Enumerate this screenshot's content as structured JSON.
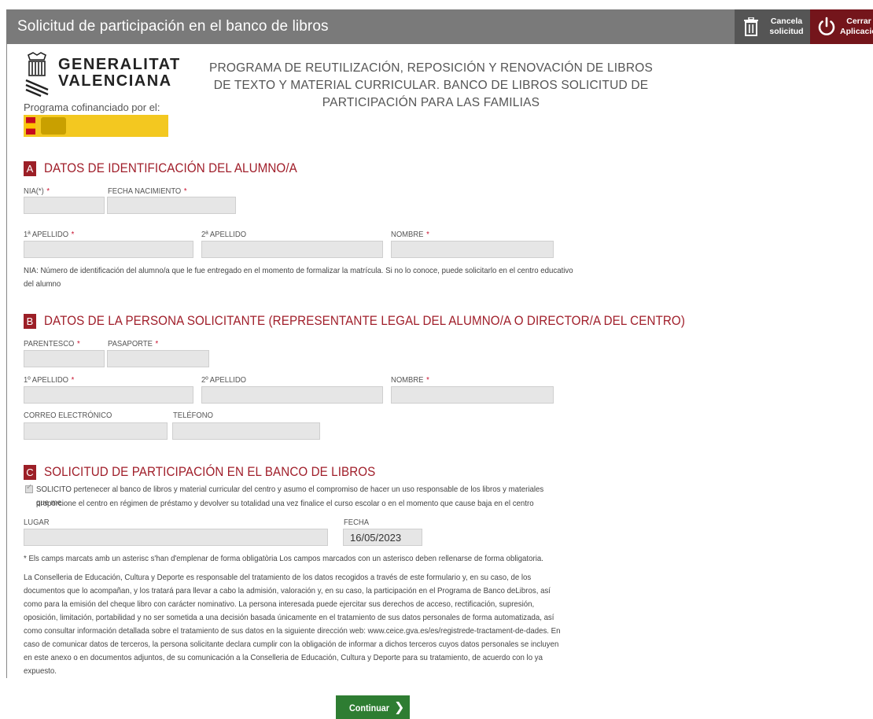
{
  "header": {
    "title": "Solicitud de participación en el banco de libros",
    "cancel_label": "Cancela solicitud",
    "close_label": "Cerrar Aplicación"
  },
  "logo": {
    "line1": "GENERALITAT",
    "line2": "VALENCIANA",
    "cofinanced": "Programa cofinanciado por el:"
  },
  "program_title": "PROGRAMA DE REUTILIZACIÓN, REPOSICIÓN Y RENOVACIÓN DE LIBROS DE TEXTO Y MATERIAL CURRICULAR. BANCO DE LIBROS SOLICITUD DE PARTICIPACIÓN PARA LAS FAMILIAS",
  "section_a": {
    "badge": "A",
    "title": "DATOS DE IDENTIFICACIÓN DEL ALUMNO/A",
    "labels": {
      "nia": "NIA(*)",
      "birth": "FECHA NACIMIENTO",
      "surname1": "1ª APELLIDO",
      "surname2": "2ª APELLIDO",
      "name": "NOMBRE"
    },
    "req": "*",
    "note": "NIA: Número de identificación del alumno/a que le fue entregado en el momento de formalizar la matrícula. Si no lo conoce, puede solicitarlo en el centro educativo del alumno"
  },
  "section_b": {
    "badge": "B",
    "title": "DATOS DE LA PERSONA SOLICITANTE (REPRESENTANTE LEGAL DEL ALUMNO/A O DIRECTOR/A DEL CENTRO)",
    "labels": {
      "relation": "PARENTESCO",
      "passport": "PASAPORTE",
      "surname1": "1º APELLIDO",
      "surname2": "2º APELLIDO",
      "name": "NOMBRE",
      "email": "CORREO ELECTRÓNICO",
      "phone": "TELÉFONO"
    },
    "req": "*"
  },
  "section_c": {
    "badge": "C",
    "title": "SOLICITUD DE PARTICIPACIÓN EN EL BANCO DE LIBROS",
    "request_text_1": "SOLICITO pertenecer al banco de libros y material curricular del centro y asumo el compromiso de hacer un uso responsable de los libros y materiales que me",
    "request_text_2": "proporcione el centro en régimen de préstamo y devolver su totalidad una vez finalice el curso escolar o en el momento que cause baja en el centro",
    "place_label": "LUGAR",
    "date_label": "FECHA",
    "date_value": "16/05/2023"
  },
  "footnote": "* Els camps marcats amb un asterisc s'han d'emplenar de forma obligatòria Los campos marcados con un asterisco deben rellenarse de forma obligatoria.",
  "legal": "La Conselleria de Educación, Cultura y Deporte es responsable del tratamiento de los datos recogidos a través de este formulario y, en su caso, de los documentos que lo acompañan, y los tratará para llevar a cabo la admisión, valoración y, en su caso, la participación en el Programa de Banco deLibros, así como para la emisión del cheque libro con carácter nominativo. La persona interesada puede ejercitar sus derechos de acceso, rectificación, supresión, oposición, limitación, portabilidad y no ser sometida a una decisión basada únicamente en el tratamiento de sus datos personales de forma automatizada, así como consultar información detallada sobre el tratamiento de sus datos en la siguiente dirección web: www.ceice.gva.es/es/registrede-tractament-de-dades. En caso de comunicar datos de terceros, la persona solicitante declara cumplir con la obligación de informar a dichos terceros cuyos datos personales se incluyen en este anexo o en documentos adjuntos, de su comunicación a la Conselleria de Educación, Cultura y Deporte para su tratamiento, de acuerdo con lo ya expuesto.",
  "continue_label": "Continuar",
  "icons": {
    "cancel": "trash-icon",
    "close": "power-icon",
    "continue": "chevron-right-icon"
  }
}
